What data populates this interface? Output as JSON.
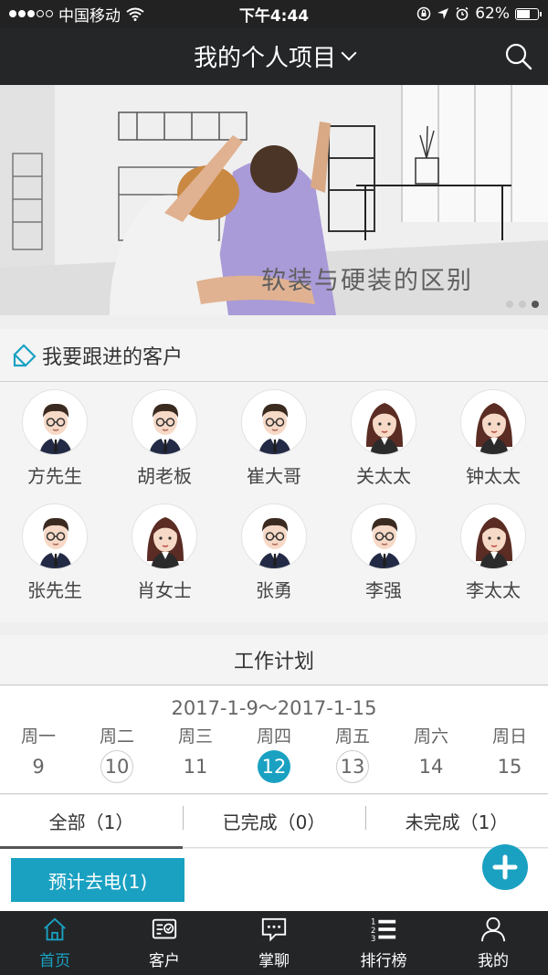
{
  "status_bar": {
    "carrier": "中国移动",
    "time": "下午4:44",
    "battery": "62%",
    "battery_level": 0.62
  },
  "nav": {
    "title": "我的个人项目"
  },
  "banner": {
    "caption": "软装与硬装的区别",
    "slide_count": 3,
    "active_slide": 3
  },
  "customers": {
    "section_title": "我要跟进的客户",
    "items": [
      {
        "name": "方先生",
        "gender": "male"
      },
      {
        "name": "胡老板",
        "gender": "male"
      },
      {
        "name": "崔大哥",
        "gender": "male"
      },
      {
        "name": "关太太",
        "gender": "female"
      },
      {
        "name": "钟太太",
        "gender": "female"
      },
      {
        "name": "张先生",
        "gender": "male"
      },
      {
        "name": "肖女士",
        "gender": "female"
      },
      {
        "name": "张勇",
        "gender": "male"
      },
      {
        "name": "李强",
        "gender": "male"
      },
      {
        "name": "李太太",
        "gender": "female"
      }
    ]
  },
  "work_plan": {
    "title": "工作计划",
    "date_range": "2017-1-9～2017-1-15",
    "days": [
      {
        "name": "周一",
        "num": "9",
        "state": "plain"
      },
      {
        "name": "周二",
        "num": "10",
        "state": "ring"
      },
      {
        "name": "周三",
        "num": "11",
        "state": "plain"
      },
      {
        "name": "周四",
        "num": "12",
        "state": "selected"
      },
      {
        "name": "周五",
        "num": "13",
        "state": "ring"
      },
      {
        "name": "周六",
        "num": "14",
        "state": "plain"
      },
      {
        "name": "周日",
        "num": "15",
        "state": "plain"
      }
    ]
  },
  "filters": {
    "all": "全部（1）",
    "done": "已完成（0）",
    "todo": "未完成（1）"
  },
  "plan_item": {
    "label": "预计去电(1)"
  },
  "tabbar": {
    "items": [
      {
        "label": "首页",
        "icon": "home-icon",
        "active": true
      },
      {
        "label": "客户",
        "icon": "customer-card-icon",
        "active": false
      },
      {
        "label": "掌聊",
        "icon": "chat-icon",
        "active": false
      },
      {
        "label": "排行榜",
        "icon": "ranking-list-icon",
        "active": false
      },
      {
        "label": "我的",
        "icon": "user-icon",
        "active": false
      }
    ]
  },
  "colors": {
    "accent": "#1aa1c2",
    "bar_dark": "#242628"
  }
}
